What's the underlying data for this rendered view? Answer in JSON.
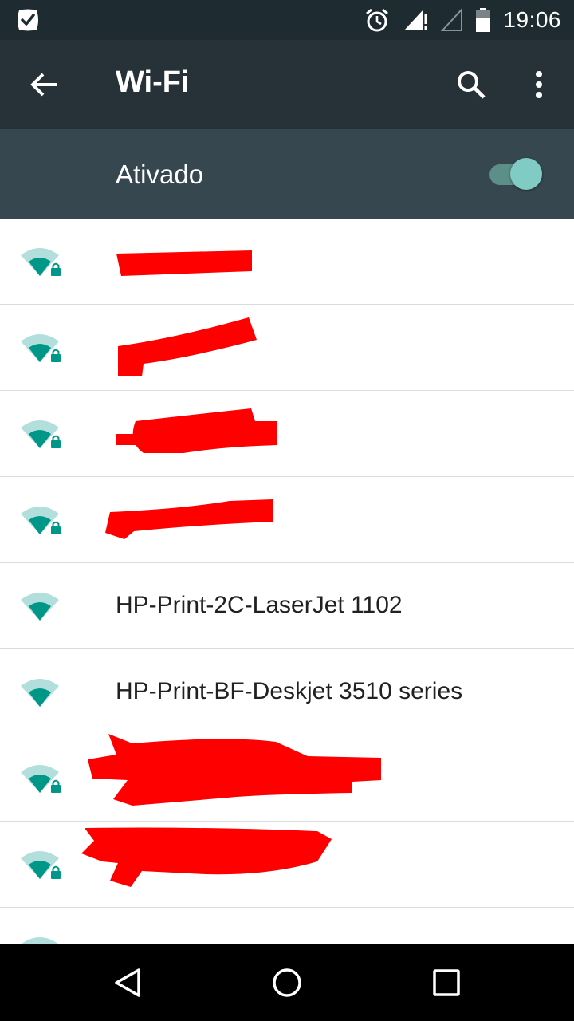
{
  "status_bar": {
    "time": "19:06",
    "icons": [
      "notification-app-icon",
      "alarm-icon",
      "signal-icon",
      "signal-empty-icon",
      "battery-icon"
    ]
  },
  "app_bar": {
    "title": "Wi-Fi",
    "back_icon": "arrow-back-icon",
    "search_icon": "search-icon",
    "more_icon": "more-vert-icon"
  },
  "master_switch": {
    "label": "Ativado",
    "checked": true
  },
  "networks": [
    {
      "ssid": "",
      "secured": true,
      "redacted": true
    },
    {
      "ssid": "",
      "secured": true,
      "redacted": true
    },
    {
      "ssid": "",
      "secured": true,
      "redacted": true
    },
    {
      "ssid": "",
      "secured": true,
      "redacted": true
    },
    {
      "ssid": "HP-Print-2C-LaserJet 1102",
      "secured": false,
      "redacted": false
    },
    {
      "ssid": "HP-Print-BF-Deskjet 3510 series",
      "secured": false,
      "redacted": false
    },
    {
      "ssid": "",
      "secured": true,
      "redacted": true
    },
    {
      "ssid": "",
      "secured": true,
      "redacted": true
    },
    {
      "ssid": "",
      "secured": false,
      "redacted": false
    }
  ],
  "nav_bar": {
    "icons": [
      "back-triangle-icon",
      "home-circle-icon",
      "recents-square-icon"
    ]
  },
  "colors": {
    "status_bar": "#1e2b30",
    "app_bar": "#263238",
    "switch_bar": "#37474f",
    "accent": "#009688",
    "toggle_thumb": "#80cbc4",
    "redaction": "#ff0000"
  }
}
